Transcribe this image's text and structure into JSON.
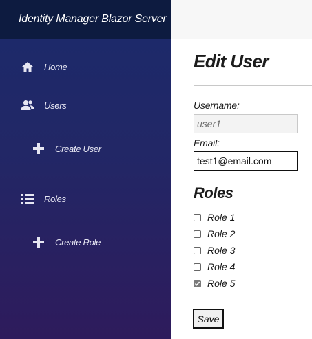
{
  "sidebar": {
    "brand": "Identity Manager Blazor Server",
    "items": [
      {
        "label": "Home",
        "icon": "home-icon"
      },
      {
        "label": "Users",
        "icon": "users-icon"
      },
      {
        "label": "Create User",
        "icon": "plus-icon"
      },
      {
        "label": "Roles",
        "icon": "list-icon"
      },
      {
        "label": "Create Role",
        "icon": "plus-icon"
      }
    ]
  },
  "main": {
    "title": "Edit User",
    "username_label": "Username:",
    "username_value": "user1",
    "email_label": "Email:",
    "email_value": "test1@email.com",
    "roles_heading": "Roles",
    "roles": [
      {
        "label": "Role 1",
        "checked": false
      },
      {
        "label": "Role 2",
        "checked": false
      },
      {
        "label": "Role 3",
        "checked": false
      },
      {
        "label": "Role 4",
        "checked": false
      },
      {
        "label": "Role 5",
        "checked": true
      }
    ],
    "save_label": "Save"
  },
  "colors": {
    "sidebar_top": "#1b2a6b",
    "sidebar_bottom": "#2e1b5c",
    "brand_bar": "#0d1b40"
  }
}
